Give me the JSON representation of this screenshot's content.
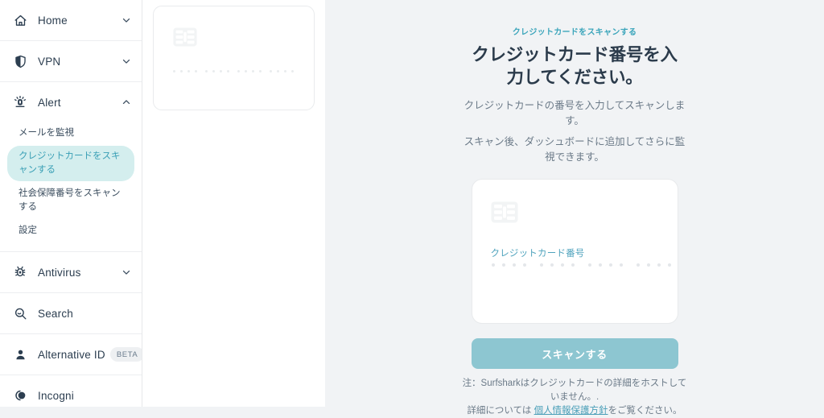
{
  "sidebar": {
    "groups": [
      {
        "icon": "home-icon",
        "label": "Home",
        "chevron": "chevron-down-icon",
        "key": "home"
      },
      {
        "icon": "shield-icon",
        "label": "VPN",
        "chevron": "chevron-down-icon",
        "key": "vpn"
      },
      {
        "icon": "alert-icon",
        "label": "Alert",
        "chevron": "chevron-up-icon",
        "key": "alert"
      },
      {
        "icon": "antivirus-bug-icon",
        "label": "Antivirus",
        "chevron": "chevron-down-icon",
        "key": "antivirus"
      },
      {
        "icon": "search-icon",
        "label": "Search",
        "chevron": null,
        "key": "search"
      },
      {
        "icon": "person-icon",
        "label": "Alternative ID",
        "badge": "BETA",
        "chevron": null,
        "key": "alternative-id"
      },
      {
        "icon": "incogni-toggle-icon",
        "label": "Incogni",
        "chevron": null,
        "key": "incogni"
      }
    ],
    "alert_sub_items": [
      {
        "label": "メールを監視",
        "active": false,
        "key": "monitor-email"
      },
      {
        "label": "クレジットカードをスキャンする",
        "active": true,
        "key": "scan-credit-card"
      },
      {
        "label": "社会保障番号をスキャンする",
        "active": false,
        "key": "scan-ssn"
      },
      {
        "label": "設定",
        "active": false,
        "key": "settings"
      }
    ]
  },
  "preview": {
    "card_chip_icon": "credit-card-chip-icon"
  },
  "main": {
    "eyebrow": "クレジットカードをスキャンする",
    "title": "クレジットカード番号を入力してください。",
    "subtitle_1": "クレジットカードの番号を入力してスキャンします。",
    "subtitle_2": "スキャン後、ダッシュボードに追加してさらに監視できます。",
    "card": {
      "chip_icon": "credit-card-chip-icon",
      "field_label": "クレジットカード番号",
      "value": "",
      "placeholder_groups": 4,
      "placeholder_dots_per_group": 4
    },
    "scan_button": "スキャンする",
    "note_line_1": "注：Surfsharkはクレジットカードの詳細をホストしていません。.",
    "note_line_2_before": "詳細については ",
    "note_link": "個人情報保護方針",
    "note_line_2_after": "をご覧ください。"
  },
  "colors": {
    "accent_teal": "#3ba5bb",
    "button_teal": "#8dc6d1",
    "active_pill_bg": "#d4eeee",
    "page_bg": "#f1f3f5",
    "panel_bg": "#ffffff",
    "text_dark": "#2b3b4b",
    "text_muted": "#6b7a88"
  }
}
